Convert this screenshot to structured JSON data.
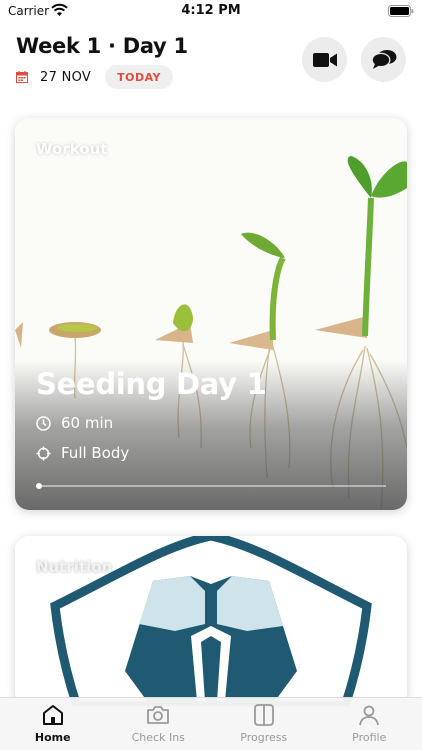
{
  "status_bar": {
    "carrier": "Carrier",
    "time": "4:12 PM"
  },
  "header": {
    "title": "Week 1 · Day 1",
    "date": "27 NOV",
    "today_badge": "TODAY",
    "video_icon": "video-camera-icon",
    "chat_icon": "chat-bubbles-icon"
  },
  "workout_card": {
    "label": "Workout",
    "title": "Seeding Day 1",
    "duration": "60 min",
    "focus": "Full Body",
    "progress": 0
  },
  "nutrition_card": {
    "label": "Nutrition"
  },
  "tab_bar": {
    "tabs": [
      {
        "label": "Home",
        "icon": "home-icon",
        "active": true
      },
      {
        "label": "Check Ins",
        "icon": "camera-icon",
        "active": false
      },
      {
        "label": "Progress",
        "icon": "compare-icon",
        "active": false
      },
      {
        "label": "Profile",
        "icon": "person-icon",
        "active": false
      }
    ]
  },
  "colors": {
    "accent_red": "#e24c3e",
    "shield_dark": "#1f5a72",
    "shield_light": "#cfe4ea"
  }
}
